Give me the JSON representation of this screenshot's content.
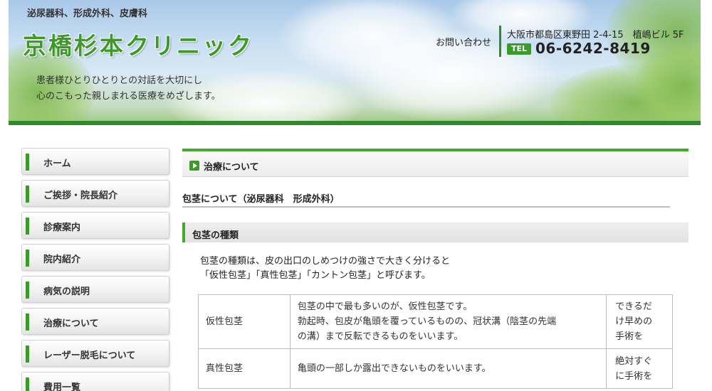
{
  "header": {
    "specialties": "泌尿器科、形成外科、皮膚科",
    "clinic_name": "京橋杉本クリニック",
    "slogan_line1": "患者様ひとりひとりとの対話を大切にし",
    "slogan_line2": "心のこもった親しまれる医療をめざします。",
    "contact_label": "お問い合わせ",
    "address": "大阪市都島区東野田 2-4-15　植嶋ビル 5F",
    "tel_badge": "TEL",
    "tel_number": "06-6242-8419"
  },
  "sidebar": {
    "items": [
      {
        "label": "ホーム"
      },
      {
        "label": "ご挨拶・院長紹介"
      },
      {
        "label": "診療案内"
      },
      {
        "label": "院内紹介"
      },
      {
        "label": "病気の説明"
      },
      {
        "label": "治療について"
      },
      {
        "label": "レーザー脱毛について"
      },
      {
        "label": "費用一覧"
      }
    ]
  },
  "main": {
    "section_heading": "治療について",
    "sub_title": "包茎について（泌尿器科　形成外科）",
    "type_heading": "包茎の種類",
    "intro_line1": "包茎の種類は、皮の出口のしめつけの強さで大きく分けると",
    "intro_line2": "「仮性包茎」「真性包茎」「カントン包茎」と呼びます。",
    "table": {
      "rows": [
        {
          "name": "仮性包茎",
          "desc_line1": "包茎の中で最も多いのが、仮性包茎です。",
          "desc_line2": "勃起時、包皮が亀頭を覆っているものの、冠状溝（陰茎の先端",
          "desc_line3": "の溝）まで反転できるものをいいます。",
          "note_line1": "できるだ",
          "note_line2": "け早めの",
          "note_line3": "手術を"
        },
        {
          "name": "真性包茎",
          "desc_line1": "亀頭の一部しか露出できないものをいいます。",
          "note_line1": "絶対すぐ",
          "note_line2": "に手術を"
        }
      ]
    }
  },
  "colors": {
    "accent_green": "#3c9a28",
    "header_bottom": "#2f8a2a"
  },
  "icons": {
    "section_heading": "play-icon"
  }
}
